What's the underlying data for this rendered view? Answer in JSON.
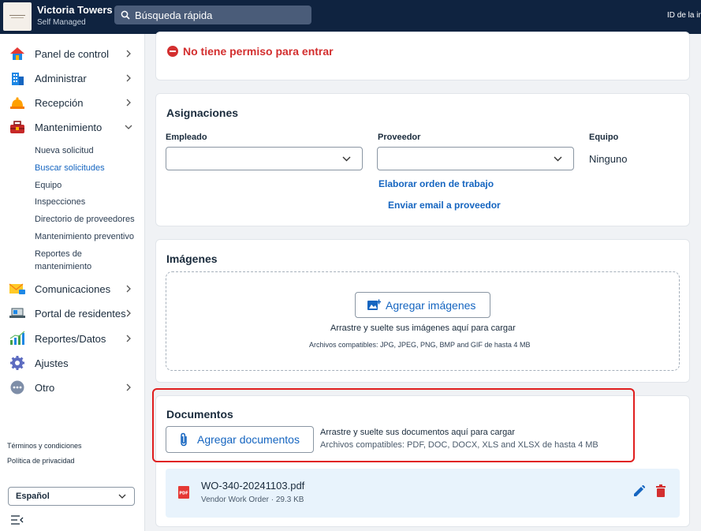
{
  "header": {
    "site_name": "Victoria Towers",
    "site_sub": "Self Managed",
    "search_placeholder": "Búsqueda rápida",
    "right_text": "ID de la in"
  },
  "sidebar": {
    "items": [
      {
        "label": "Panel de control",
        "icon": "house-icon"
      },
      {
        "label": "Administrar",
        "icon": "building-icon"
      },
      {
        "label": "Recepción",
        "icon": "bell-icon"
      },
      {
        "label": "Mantenimiento",
        "icon": "toolbox-icon"
      },
      {
        "label": "Comunicaciones",
        "icon": "mail-icon"
      },
      {
        "label": "Portal de residentes",
        "icon": "laptop-icon"
      },
      {
        "label": "Reportes/Datos",
        "icon": "bar-chart-icon"
      },
      {
        "label": "Ajustes",
        "icon": "gear-icon"
      },
      {
        "label": "Otro",
        "icon": "more-icon"
      }
    ],
    "sub_items": [
      "Nueva solicitud",
      "Buscar solicitudes",
      "Equipo",
      "Inspecciones",
      "Directorio de proveedores",
      "Mantenimiento preventivo",
      "Reportes de",
      "mantenimiento"
    ],
    "footer": {
      "terms": "Términos y condiciones",
      "privacy": "Política de privacidad"
    },
    "language": "Español"
  },
  "permission": {
    "message": "No tiene permiso para entrar"
  },
  "assignments": {
    "title": "Asignaciones",
    "employee_label": "Empleado",
    "provider_label": "Proveedor",
    "team_label": "Equipo",
    "team_value": "Ninguno",
    "work_order_link": "Elaborar orden de trabajo",
    "email_link": "Enviar email a proveedor"
  },
  "images": {
    "title": "Imágenes",
    "button": "Agregar imágenes",
    "drop_text": "Arrastre y suelte sus imágenes aquí para cargar",
    "compat": "Archivos compatibles: JPG, JPEG, PNG, BMP and GIF de hasta 4 MB"
  },
  "documents": {
    "title": "Documentos",
    "button": "Agregar documentos",
    "drop_text": "Arrastre y suelte sus documentos aquí para cargar",
    "compat": "Archivos compatibles: PDF, DOC, DOCX, XLS and XLSX de hasta 4 MB",
    "file": {
      "name": "WO-340-20241103.pdf",
      "meta": "Vendor Work Order · 29.3 KB"
    }
  },
  "colors": {
    "topbar": "#0f2340",
    "accent": "#1565c0",
    "danger": "#d32f2f",
    "highlight": "#e01e1e"
  }
}
